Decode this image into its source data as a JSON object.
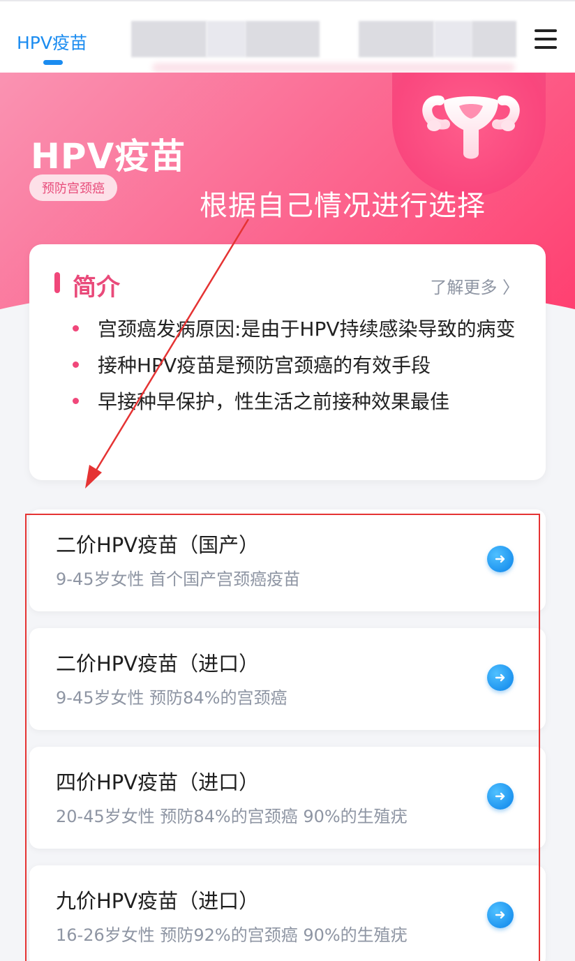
{
  "topbar": {
    "active_tab": "HPV疫苗"
  },
  "hero": {
    "title": "HPV疫苗",
    "tag": "预防宫颈癌",
    "icon": "uterus-icon"
  },
  "annotation": {
    "text": "根据自己情况进行选择",
    "color": "#e53333"
  },
  "intro": {
    "title": "简介",
    "more": "了解更多 〉",
    "bullets": [
      "宫颈癌发病原因:是由于HPV持续感染导致的病变",
      "接种HPV疫苗是预防宫颈癌的有效手段",
      "早接种早保护，性生活之前接种效果最佳"
    ]
  },
  "vaccines": [
    {
      "name": "二价HPV疫苗（国产）",
      "desc": "9-45岁女性 首个国产宫颈癌疫苗"
    },
    {
      "name": "二价HPV疫苗（进口）",
      "desc": "9-45岁女性 预防84%的宫颈癌"
    },
    {
      "name": "四价HPV疫苗（进口）",
      "desc": "20-45岁女性 预防84%的宫颈癌 90%的生殖疣"
    },
    {
      "name": "九价HPV疫苗（进口）",
      "desc": "16-26岁女性 预防92%的宫颈癌 90%的生殖疣"
    }
  ],
  "colors": {
    "accent": "#1b8cf0",
    "pink": "#f0477a",
    "arrow_button": "#1f95f0"
  }
}
